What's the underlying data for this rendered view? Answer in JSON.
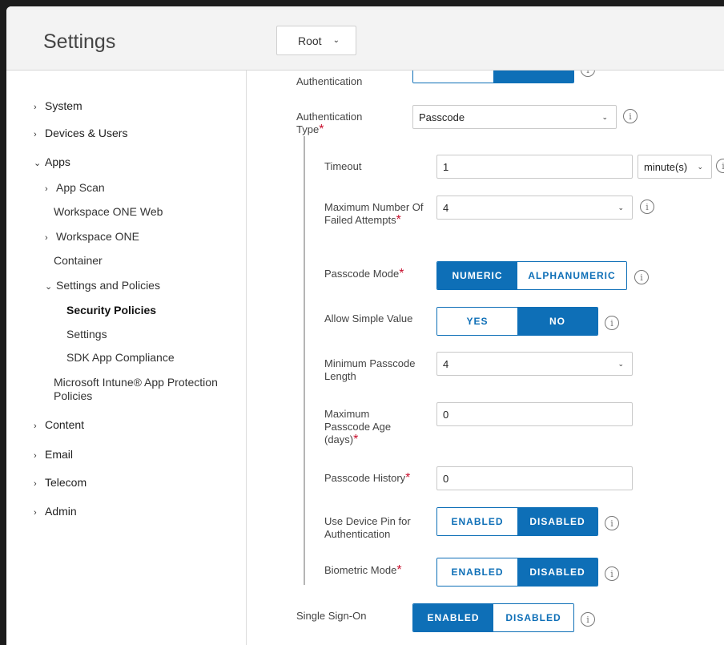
{
  "header": {
    "title": "Settings",
    "org_selector": {
      "value": "Root"
    }
  },
  "sidebar": {
    "items": [
      {
        "label": "System"
      },
      {
        "label": "Devices & Users"
      },
      {
        "label": "Apps"
      },
      {
        "label": "App Scan"
      },
      {
        "label": "Workspace ONE Web"
      },
      {
        "label": "Workspace ONE"
      },
      {
        "label": "Container"
      },
      {
        "label": "Settings and Policies"
      },
      {
        "label": "Security Policies"
      },
      {
        "label": "Settings"
      },
      {
        "label": "SDK App Compliance"
      },
      {
        "label": "Microsoft Intune® App Protection Policies"
      },
      {
        "label": "Content"
      },
      {
        "label": "Email"
      },
      {
        "label": "Telecom"
      },
      {
        "label": "Admin"
      }
    ]
  },
  "form": {
    "required_mark": "*",
    "info_glyph": "i",
    "authentication": {
      "label": "Authentication"
    },
    "authentication_type": {
      "label": "Authentication Type",
      "value": "Passcode"
    },
    "timeout": {
      "label": "Timeout",
      "value": "1",
      "unit": "minute(s)"
    },
    "max_failed": {
      "label": "Maximum Number Of Failed Attempts",
      "value": "4"
    },
    "passcode_mode": {
      "label": "Passcode Mode",
      "options": [
        "NUMERIC",
        "ALPHANUMERIC"
      ],
      "selected": "NUMERIC"
    },
    "allow_simple": {
      "label": "Allow Simple Value",
      "options": [
        "YES",
        "NO"
      ],
      "selected": "NO"
    },
    "min_length": {
      "label": "Minimum Passcode Length",
      "value": "4"
    },
    "max_age": {
      "label": "Maximum Passcode Age (days)",
      "value": "0"
    },
    "history": {
      "label": "Passcode History",
      "value": "0"
    },
    "device_pin": {
      "label": "Use Device Pin for Authentication",
      "options": [
        "ENABLED",
        "DISABLED"
      ],
      "selected": "DISABLED"
    },
    "biometric": {
      "label": "Biometric Mode",
      "options": [
        "ENABLED",
        "DISABLED"
      ],
      "selected": "DISABLED"
    },
    "sso": {
      "label": "Single Sign-On",
      "options": [
        "ENABLED",
        "DISABLED"
      ],
      "selected": "ENABLED"
    }
  },
  "colors": {
    "accent": "#0e6fb7",
    "required": "#c8102e"
  }
}
